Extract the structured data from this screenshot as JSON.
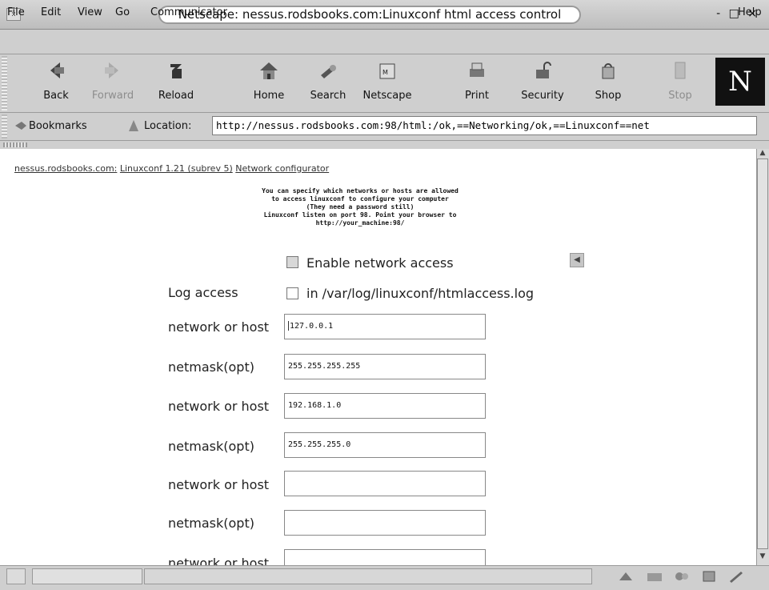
{
  "window": {
    "title": "Netscape: nessus.rodsbooks.com:Linuxconf html access control",
    "controls": "- □ ×",
    "menu_glyph": "::"
  },
  "menubar": [
    "File",
    "Edit",
    "View",
    "Go",
    "Communicator",
    "Help"
  ],
  "toolbar": {
    "back": "Back",
    "forward": "Forward",
    "reload": "Reload",
    "home": "Home",
    "search": "Search",
    "netscape": "Netscape",
    "print": "Print",
    "security": "Security",
    "shop": "Shop",
    "stop": "Stop",
    "logo": "N"
  },
  "location_bar": {
    "bookmarks": "Bookmarks",
    "location_label": "Location:",
    "url": "http://nessus.rodsbooks.com:98/html:/ok,==Networking/ok,==Linuxconf==net"
  },
  "content": {
    "breadcrumb": {
      "host": "nessus.rodsbooks.com:",
      "app": "Linuxconf 1.21 (subrev 5)",
      "page": "Network configurator"
    },
    "info_lines": [
      "You can specify which networks or hosts are allowed",
      "to access linuxconf to configure your computer",
      "(They need a password still)",
      "Linuxconf listen on port 98. Point your browser to",
      "http://your_machine:98/"
    ],
    "enable_label": "Enable network access",
    "log_label": "Log access",
    "log_checkbox_label": "in /var/log/linuxconf/htmlaccess.log",
    "rows": [
      {
        "label": "network or host",
        "value": "127.0.0.1"
      },
      {
        "label": "netmask(opt)",
        "value": "255.255.255.255"
      },
      {
        "label": "network or host",
        "value": "192.168.1.0"
      },
      {
        "label": "netmask(opt)",
        "value": "255.255.255.0"
      },
      {
        "label": "network or host",
        "value": ""
      },
      {
        "label": "netmask(opt)",
        "value": ""
      },
      {
        "label": "network or host",
        "value": ""
      }
    ]
  }
}
